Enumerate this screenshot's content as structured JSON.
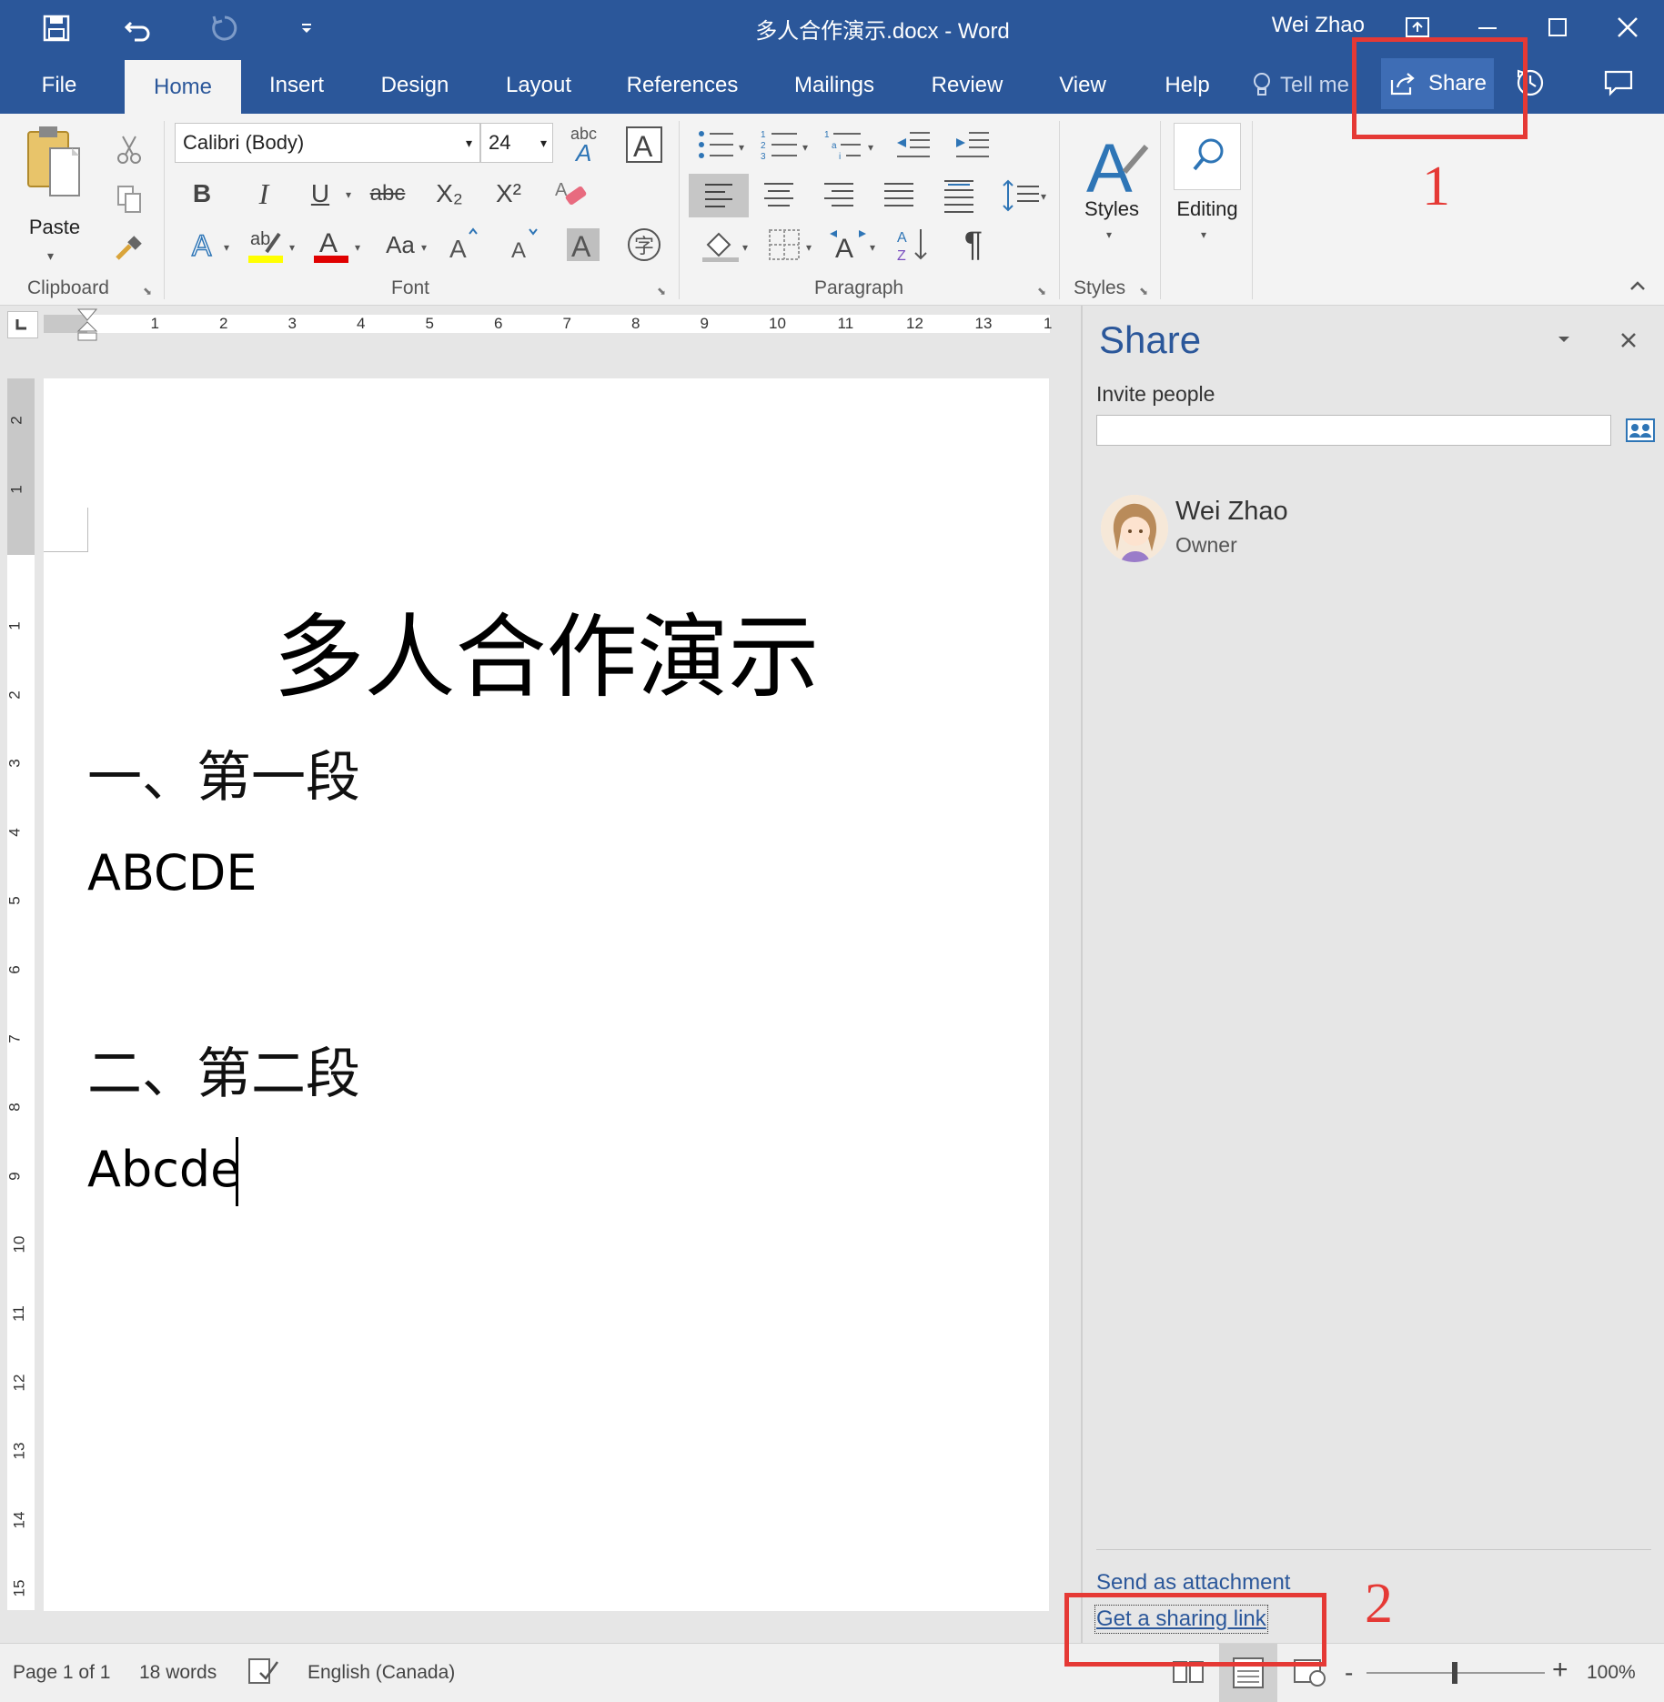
{
  "window": {
    "title": "多人合作演示.docx  -  Word",
    "user": "Wei Zhao"
  },
  "tabs": [
    "File",
    "Home",
    "Insert",
    "Design",
    "Layout",
    "References",
    "Mailings",
    "Review",
    "View",
    "Help"
  ],
  "tell_me": "Tell me",
  "share_button": "Share",
  "ribbon": {
    "clipboard": {
      "label": "Clipboard",
      "paste": "Paste"
    },
    "font": {
      "label": "Font",
      "name": "Calibri (Body)",
      "size": "24",
      "bold": "B",
      "italic": "I",
      "underline": "U",
      "strike": "abc",
      "subscript": "X₂",
      "superscript": "X²",
      "change_case": "Aa",
      "text_effects": "A",
      "enclose": "字"
    },
    "paragraph": {
      "label": "Paragraph",
      "pilcrow": "¶"
    },
    "styles": {
      "label": "Styles",
      "button": "Styles"
    },
    "editing": {
      "button": "Editing"
    }
  },
  "ruler": {
    "h_ticks": [
      "1",
      "2",
      "3",
      "4",
      "5",
      "6",
      "7",
      "8",
      "9",
      "10",
      "11",
      "12",
      "13",
      "1"
    ],
    "v_ticks_top": [
      "2",
      "1"
    ],
    "v_ticks": [
      "1",
      "2",
      "3",
      "4",
      "5",
      "6",
      "7",
      "8",
      "9",
      "10",
      "11",
      "12",
      "13",
      "14",
      "15"
    ]
  },
  "document": {
    "title": "多人合作演示",
    "heading1": "一、第一段",
    "para1": "ABCDE",
    "heading2": "二、第二段",
    "para2": "Abcde"
  },
  "share_pane": {
    "title": "Share",
    "invite_label": "Invite people",
    "invite_value": "",
    "person": {
      "name": "Wei Zhao",
      "role": "Owner"
    },
    "send_attachment": "Send as attachment",
    "sharing_link": "Get a sharing link"
  },
  "annotations": {
    "step1": "1",
    "step2": "2"
  },
  "status_bar": {
    "page": "Page 1 of 1",
    "words": "18 words",
    "language": "English (Canada)",
    "zoom": "100%"
  },
  "colors": {
    "brand": "#2b579a",
    "callout": "#e53935"
  }
}
